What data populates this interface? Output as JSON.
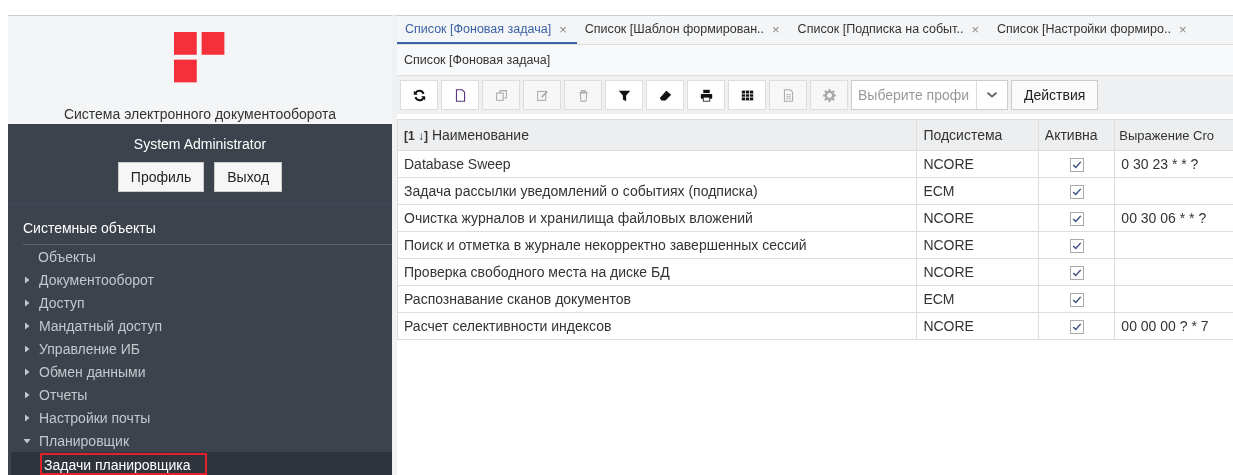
{
  "sidebar": {
    "app_title": "Система электронного документооборота",
    "user": "System Administrator",
    "buttons": [
      "Профиль",
      "Выход"
    ],
    "section": "Системные объекты",
    "items": [
      {
        "label": "Объекты",
        "selected": false
      },
      {
        "label": "Документооборот",
        "expanded": false,
        "selected": false
      },
      {
        "label": "Доступ",
        "expanded": false,
        "selected": false
      },
      {
        "label": "Мандатный доступ",
        "expanded": false,
        "selected": false
      },
      {
        "label": "Управление ИБ",
        "expanded": false,
        "selected": false
      },
      {
        "label": "Обмен данными",
        "expanded": false,
        "selected": false
      },
      {
        "label": "Отчеты",
        "expanded": false,
        "selected": false
      },
      {
        "label": "Настройки почты",
        "expanded": false,
        "selected": false
      },
      {
        "label": "Планировщик",
        "expanded": true,
        "selected": false,
        "children": [
          {
            "label": "Задачи планировщика",
            "selected": true
          }
        ]
      }
    ]
  },
  "tabs": [
    {
      "label": "Список [Фоновая задача]",
      "close": "×",
      "selected": true
    },
    {
      "label": "Список [Шаблон формирован..",
      "close": "×",
      "selected": false
    },
    {
      "label": "Список [Подписка на событ..",
      "close": "×",
      "selected": false
    },
    {
      "label": "Список [Настройки формиро..",
      "close": "×",
      "selected": false
    }
  ],
  "breadcrumb": "Список [Фоновая задача]",
  "toolbar": {
    "tools": [
      {
        "kind": "refresh",
        "disabled": false
      },
      {
        "kind": "new",
        "disabled": false
      },
      {
        "kind": "copy",
        "disabled": true
      },
      {
        "kind": "edit",
        "disabled": true
      },
      {
        "kind": "delete",
        "disabled": true
      },
      {
        "kind": "filter",
        "disabled": false
      },
      {
        "kind": "eraser",
        "disabled": false
      },
      {
        "kind": "print",
        "disabled": false
      },
      {
        "kind": "grid",
        "disabled": false
      },
      {
        "kind": "document",
        "disabled": true
      },
      {
        "kind": "settings",
        "disabled": true
      }
    ],
    "profile_select": {
      "placeholder": "Выберите профи"
    },
    "actions_button": "Действия"
  },
  "table": {
    "columns": [
      "**[1 ↓]** Наименование",
      "Подсистема",
      "Активна",
      "Выражение Cro"
    ],
    "rows": [
      {
        "name": "Database Sweep",
        "subsystem": "NCORE",
        "active": true,
        "cron": "0 30 23 * * ?"
      },
      {
        "name": "Задача рассылки уведомлений о событиях (подписка)",
        "subsystem": "ECM",
        "active": true
      },
      {
        "name": "Очистка журналов и хранилища файловых вложений",
        "subsystem": "NCORE",
        "active": true,
        "cron": "00 30 06 * * ?"
      },
      {
        "name": "Поиск и отметка в журнале некорректно завершенных сессий",
        "subsystem": "NCORE",
        "active": true
      },
      {
        "name": "Проверка свободного места на диске БД",
        "subsystem": "NCORE",
        "active": true
      },
      {
        "name": "Распознавание сканов документов",
        "subsystem": "ECM",
        "active": true
      },
      {
        "name": "Расчет селективности индексов",
        "subsystem": "NCORE",
        "active": true,
        "cron": "00 00 00 ? * 7"
      }
    ]
  }
}
